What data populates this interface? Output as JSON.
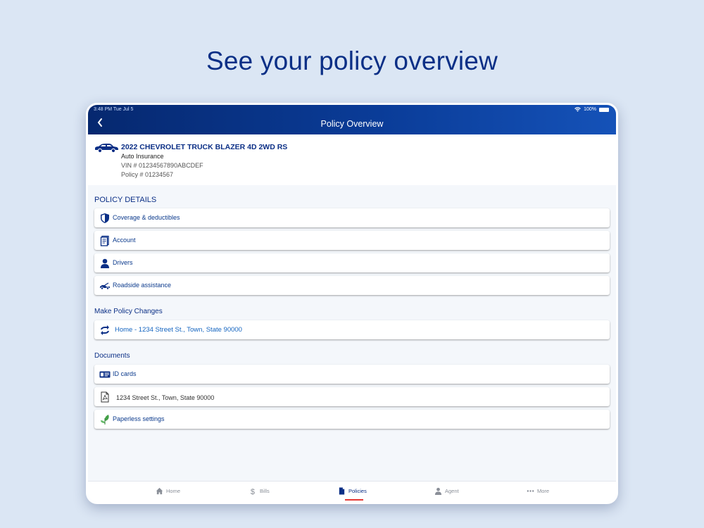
{
  "headline": "See your policy overview",
  "status_bar": {
    "time": "3:48 PM  Tue Jul 5",
    "battery": "100%"
  },
  "header": {
    "title": "Policy Overview"
  },
  "vehicle": {
    "name": "2022 CHEVROLET TRUCK BLAZER 4D 2WD RS",
    "type": "Auto Insurance",
    "vin": "VIN # 01234567890ABCDEF",
    "policy": "Policy # 01234567"
  },
  "policy_details": {
    "title": "POLICY DETAILS",
    "items": [
      {
        "label": "Coverage & deductibles",
        "icon": "shield-icon"
      },
      {
        "label": "Account",
        "icon": "document-icon"
      },
      {
        "label": "Drivers",
        "icon": "person-icon"
      },
      {
        "label": "Roadside assistance",
        "icon": "tow-truck-icon"
      }
    ]
  },
  "policy_changes": {
    "title": "Make Policy Changes",
    "items": [
      {
        "label": "Home - 1234 Street St., Town, State 90000",
        "icon": "refresh-arrows-icon"
      }
    ]
  },
  "documents": {
    "title": "Documents",
    "items": [
      {
        "label": "ID cards",
        "icon": "id-card-icon"
      },
      {
        "label": "1234 Street St., Town, State 90000",
        "icon": "pdf-icon"
      },
      {
        "label": "Paperless settings",
        "icon": "leaf-icon"
      }
    ]
  },
  "tabbar": {
    "items": [
      {
        "label": "Home",
        "icon": "home-icon"
      },
      {
        "label": "Bills",
        "icon": "dollar-icon"
      },
      {
        "label": "Policies",
        "icon": "policy-document-icon",
        "active": true
      },
      {
        "label": "Agent",
        "icon": "agent-icon"
      },
      {
        "label": "More",
        "icon": "more-dots-icon"
      }
    ]
  },
  "colors": {
    "brand": "#0b2f86",
    "link": "#1565c0",
    "accent_tab": "#e53935",
    "leaf": "#43a047"
  }
}
